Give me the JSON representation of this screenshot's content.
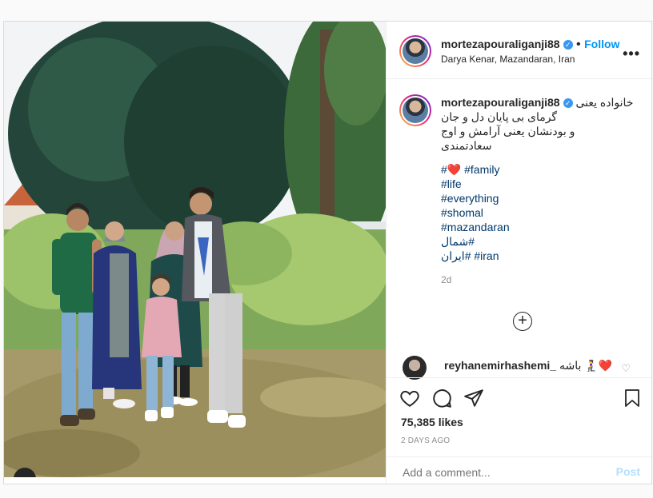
{
  "post": {
    "author": "mortezapouraliganji88",
    "follow_label": "Follow",
    "location": "Darya Kenar, Mazandaran, Iran",
    "more_label": "•••",
    "caption_lines": [
      "خانواده یعنی",
      "گرمای بی پایان دل و جان",
      "و بودنشان یعنی آرامش و اوج",
      "سعادتمندی"
    ],
    "hashtags": [
      {
        "prefix": "#",
        "emoji": "❤️",
        "tag": "#family"
      },
      {
        "tag": "#life"
      },
      {
        "tag": "#everything"
      },
      {
        "tag": "#shomal"
      },
      {
        "tag": "#mazandaran"
      },
      {
        "tag": "شمال#"
      },
      {
        "tag": "ایران#",
        "tag2": "#iran"
      }
    ],
    "time_short": "2d",
    "load_more_icon": "plus-circle-icon",
    "comment": {
      "user": "reyhanemirhashemi_",
      "text": "باشه 🧎‍♀️❤️"
    },
    "likes": "75,385 likes",
    "time_long": "2 DAYS AGO",
    "add_comment_placeholder": "Add a comment...",
    "post_button": "Post"
  },
  "colors": {
    "accent": "#0095f6",
    "hashtag": "#00376b",
    "heart": "#ed4956"
  }
}
